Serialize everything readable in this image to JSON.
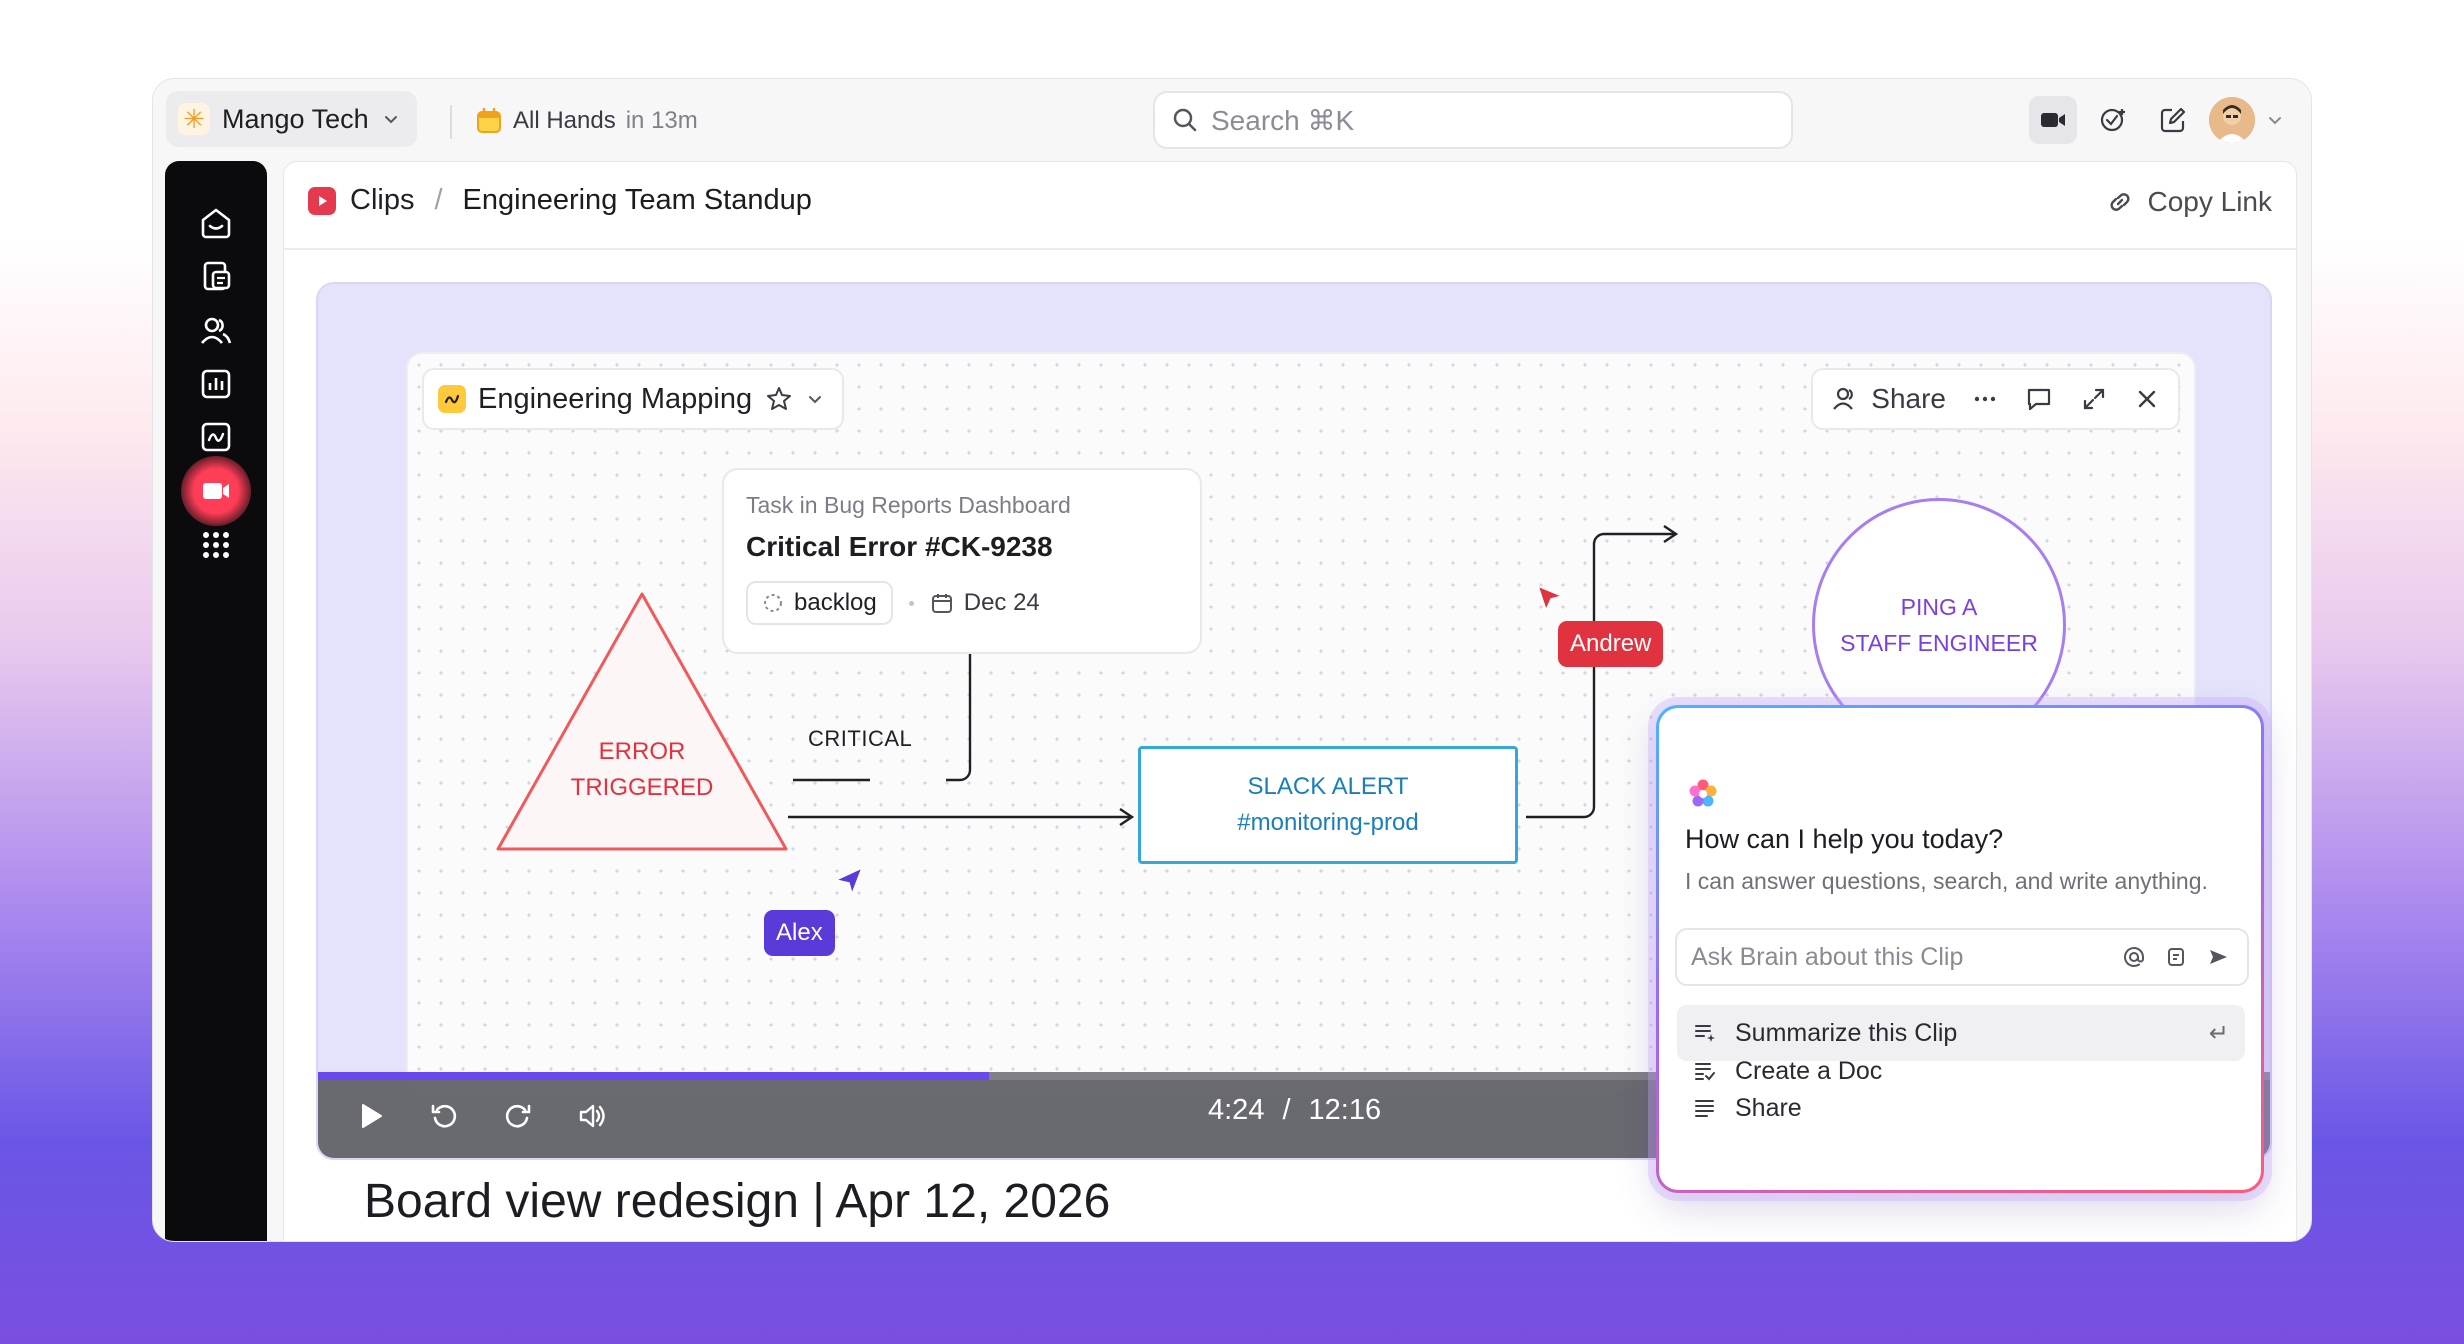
{
  "topbar": {
    "workspace": "Mango Tech",
    "event_name": "All Hands",
    "event_time": "in 13m",
    "search_placeholder": "Search ⌘K"
  },
  "breadcrumb": {
    "section": "Clips",
    "separator": "/",
    "current": "Engineering Team Standup",
    "copy_link": "Copy Link"
  },
  "whiteboard": {
    "title": "Engineering Mapping",
    "share": "Share",
    "task_card": {
      "meta": "Task in Bug Reports Dashboard",
      "title": "Critical Error #CK-9238",
      "status": "backlog",
      "date": "Dec 24"
    },
    "triangle_line1": "ERROR",
    "triangle_line2": "TRIGGERED",
    "critical_label": "CRITICAL",
    "slack_line1": "SLACK ALERT",
    "slack_line2": "#monitoring-prod",
    "ping_line1": "PING A",
    "ping_line2": "STAFF ENGINEER",
    "cursor_andrew": "Andrew",
    "cursor_alex": "Alex"
  },
  "player": {
    "current_time": "4:24",
    "separator": "/",
    "duration": "12:16",
    "progress": 0.344
  },
  "doc_title": "Board view redesign | Apr 12, 2026",
  "brain": {
    "title": "How can I help you today?",
    "subtitle": "I can answer questions, search, and write anything.",
    "input_placeholder": "Ask Brain about this Clip",
    "actions": [
      "Summarize this Clip",
      "Create a Doc",
      "Share"
    ]
  },
  "colors": {
    "accent_red": "#e0323f",
    "accent_purple": "#6b47f0",
    "slack_blue": "#34a8d8",
    "ping_purple": "#a67ef2"
  }
}
